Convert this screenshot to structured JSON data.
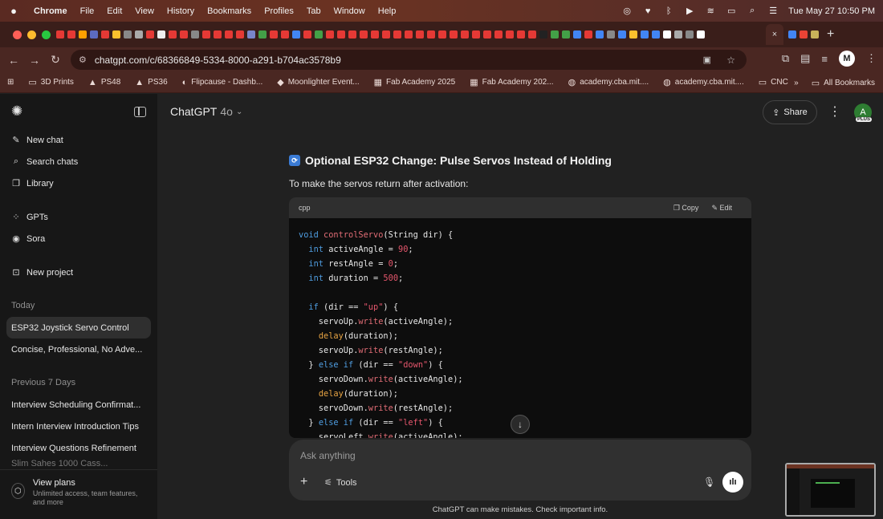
{
  "menubar": {
    "app": "Chrome",
    "items": [
      "File",
      "Edit",
      "View",
      "History",
      "Bookmarks",
      "Profiles",
      "Tab",
      "Window",
      "Help"
    ],
    "datetime": "Tue May 27  10:50 PM"
  },
  "browser": {
    "url": "chatgpt.com/c/68366849-5334-8000-a291-b704ac3578b9",
    "profile_initial": "M",
    "active_tab_close": "×",
    "new_tab": "+"
  },
  "bookmarks": {
    "items": [
      {
        "icon": "folder-icon",
        "label": "3D Prints"
      },
      {
        "icon": "triangle-icon",
        "label": "PS48"
      },
      {
        "icon": "triangle-icon",
        "label": "PS36"
      },
      {
        "icon": "circle-icon",
        "label": "Flipcause - Dashb..."
      },
      {
        "icon": "bookmark-icon",
        "label": "Moonlighter Event..."
      },
      {
        "icon": "fab-icon",
        "label": "Fab Academy 2025"
      },
      {
        "icon": "fab-icon",
        "label": "Fab Academy 202..."
      },
      {
        "icon": "globe-icon",
        "label": "academy.cba.mit...."
      },
      {
        "icon": "globe-icon",
        "label": "academy.cba.mit...."
      },
      {
        "icon": "folder-icon",
        "label": "CNC"
      }
    ],
    "more": "»",
    "all_bookmarks": "All Bookmarks"
  },
  "sidebar": {
    "actions": [
      {
        "icon": "edit-icon",
        "label": "New chat"
      },
      {
        "icon": "search-icon",
        "label": "Search chats"
      },
      {
        "icon": "library-icon",
        "label": "Library"
      }
    ],
    "gpts": [
      {
        "icon": "grid-icon",
        "label": "GPTs"
      },
      {
        "icon": "sora-icon",
        "label": "Sora"
      }
    ],
    "project": {
      "icon": "folder-plus-icon",
      "label": "New project"
    },
    "today_heading": "Today",
    "today_chats": [
      "ESP32 Joystick Servo Control",
      "Concise, Professional, No Adve..."
    ],
    "prev_heading": "Previous 7 Days",
    "prev_chats": [
      "Interview Scheduling Confirmat...",
      "Intern Interview Introduction Tips",
      "Interview Questions Refinement",
      "Slim Sahes 1000 Cass..."
    ],
    "plans": {
      "title": "View plans",
      "subtitle": "Unlimited access, team features, and more"
    }
  },
  "header": {
    "model": "ChatGPT",
    "version": "4o",
    "share_label": "Share",
    "avatar_initial": "A",
    "badge": "PLUS"
  },
  "message": {
    "heading": "Optional ESP32 Change: Pulse Servos Instead of Holding",
    "intro": "To make the servos return after activation:",
    "code_lang": "cpp",
    "copy_label": "Copy",
    "edit_label": "Edit"
  },
  "composer": {
    "placeholder": "Ask anything",
    "tools_label": "Tools"
  },
  "disclaimer": "ChatGPT can make mistakes. Check important info.",
  "colors": {
    "sidebar_bg": "#171717",
    "main_bg": "#212121",
    "code_keyword": "#4f9de0",
    "code_function": "#e06c75",
    "code_number": "#e5566c",
    "code_call": "#e6a343"
  }
}
